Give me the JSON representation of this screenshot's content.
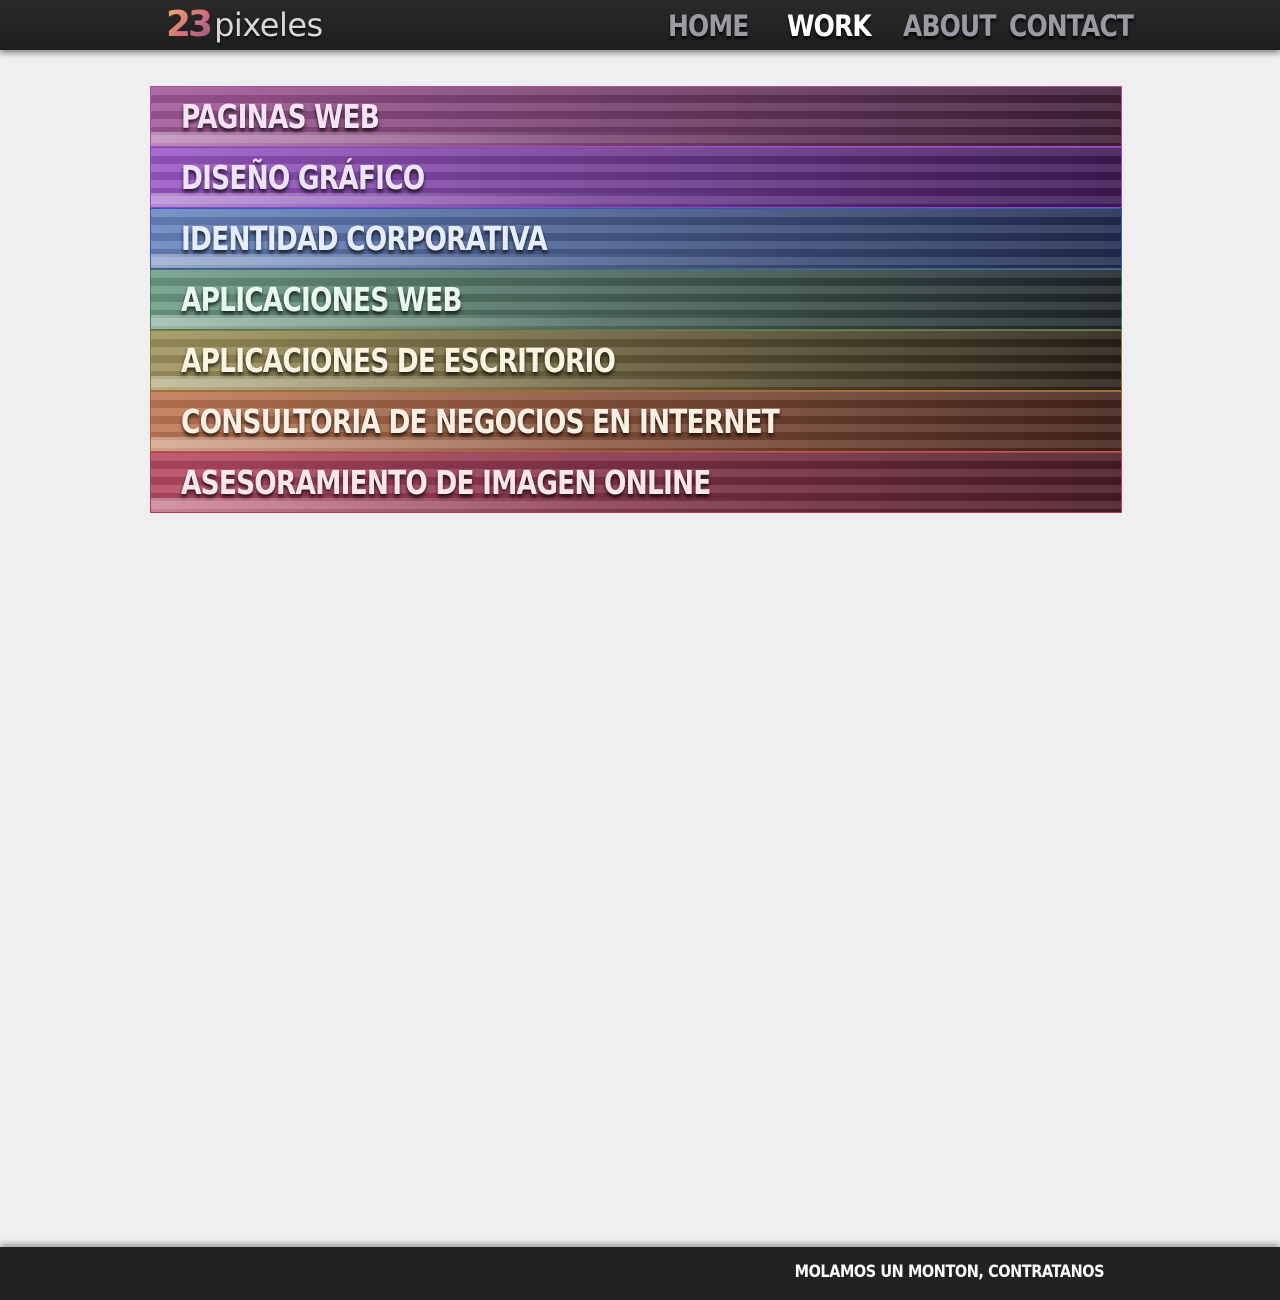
{
  "header": {
    "logo": {
      "number": "23",
      "word": "pixeles"
    },
    "nav": [
      {
        "label": "HOME",
        "active": false
      },
      {
        "label": "WORK",
        "active": true
      },
      {
        "label": "ABOUT",
        "active": false
      },
      {
        "label": "CONTACT",
        "active": false
      }
    ]
  },
  "services": [
    {
      "label": "PAGINAS WEB",
      "color_left": "#a45a9a",
      "color_right": "#3f2038",
      "border": "#b04fa0",
      "text_color": "#f7e3f5"
    },
    {
      "label": "DISEÑO GRÁFICO",
      "color_left": "#9c5ac8",
      "color_right": "#3e1a55",
      "border": "#8a44d6",
      "text_color": "#efe2fb"
    },
    {
      "label": "IDENTIDAD CORPORATIVA",
      "color_left": "#6a86c2",
      "color_right": "#222d50",
      "border": "#3d54b8",
      "text_color": "#e5ecfb"
    },
    {
      "label": "APLICACIONES WEB",
      "color_left": "#6f9e86",
      "color_right": "#20262a",
      "border": "#3f7a5f",
      "text_color": "#e9f8ee"
    },
    {
      "label": "APLICACIONES DE ESCRITORIO",
      "color_left": "#a0955e",
      "color_right": "#2a2117",
      "border": "#8a7a38",
      "text_color": "#fbf4e0"
    },
    {
      "label": "CONSULTORIA DE NEGOCIOS EN INTERNET",
      "color_left": "#c17a55",
      "color_right": "#44231c",
      "border": "#b8623a",
      "text_color": "#fbeee2"
    },
    {
      "label": "ASESORAMIENTO DE IMAGEN ONLINE",
      "color_left": "#b84a64",
      "color_right": "#4a1c27",
      "border": "#b83b55",
      "text_color": "#fbe6ec"
    }
  ],
  "footer": {
    "tagline": "MOLAMOS UN MONTON, CONTRATANOS"
  }
}
